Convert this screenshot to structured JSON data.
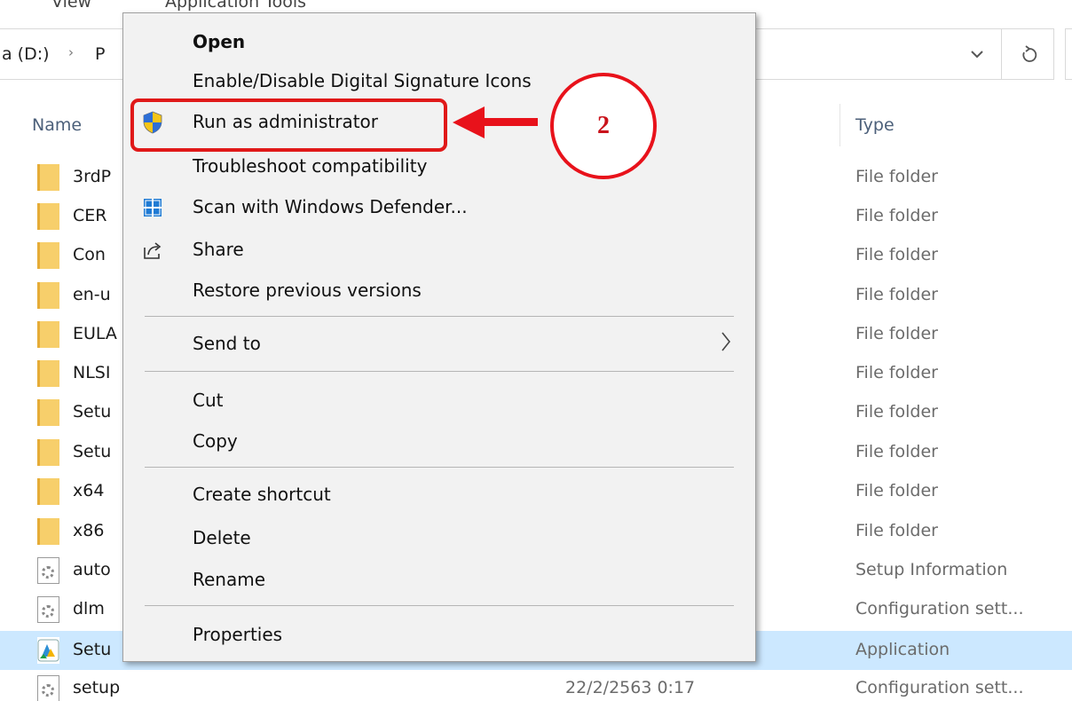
{
  "ribbon": {
    "tab_view": "View",
    "tab_application_tools": "Application Tools"
  },
  "address": {
    "drive": "a (D:)",
    "separator": "›",
    "segment": "P"
  },
  "columns": {
    "name": "Name",
    "type": "Type"
  },
  "files": [
    {
      "name": "3rdP",
      "type": "File folder",
      "icon": "folder-icon"
    },
    {
      "name": "CER",
      "type": "File folder",
      "icon": "folder-icon"
    },
    {
      "name": "Con",
      "type": "File folder",
      "icon": "folder-icon"
    },
    {
      "name": "en-u",
      "type": "File folder",
      "icon": "folder-icon"
    },
    {
      "name": "EULA",
      "type": "File folder",
      "icon": "folder-icon"
    },
    {
      "name": "NLSI",
      "type": "File folder",
      "icon": "folder-icon"
    },
    {
      "name": "Setu",
      "type": "File folder",
      "icon": "folder-icon"
    },
    {
      "name": "Setu",
      "type": "File folder",
      "icon": "folder-icon"
    },
    {
      "name": "x64",
      "type": "File folder",
      "icon": "folder-icon"
    },
    {
      "name": "x86",
      "type": "File folder",
      "icon": "folder-icon"
    },
    {
      "name": "auto",
      "type": "Setup Information",
      "icon": "settings-file-icon"
    },
    {
      "name": "dlm",
      "type": "Configuration sett...",
      "icon": "settings-file-icon"
    },
    {
      "name": "Setu",
      "type": "Application",
      "icon": "app-icon"
    },
    {
      "name": "setup",
      "date": "22/2/2563 0:17",
      "type": "Configuration sett...",
      "icon": "settings-file-icon"
    }
  ],
  "context_menu": {
    "open": "Open",
    "signature": "Enable/Disable Digital Signature Icons",
    "run_as_admin": "Run as administrator",
    "troubleshoot": "Troubleshoot compatibility",
    "scan": "Scan with Windows Defender...",
    "share": "Share",
    "restore": "Restore previous versions",
    "send_to": "Send to",
    "cut": "Cut",
    "copy": "Copy",
    "create_shortcut": "Create shortcut",
    "delete": "Delete",
    "rename": "Rename",
    "properties": "Properties"
  },
  "annotation": {
    "step": "2",
    "color": "#e8121b"
  },
  "colors": {
    "selected_row": "#cce8ff",
    "menu_bg": "#f2f2f2",
    "folder": "#f7cf6b"
  }
}
